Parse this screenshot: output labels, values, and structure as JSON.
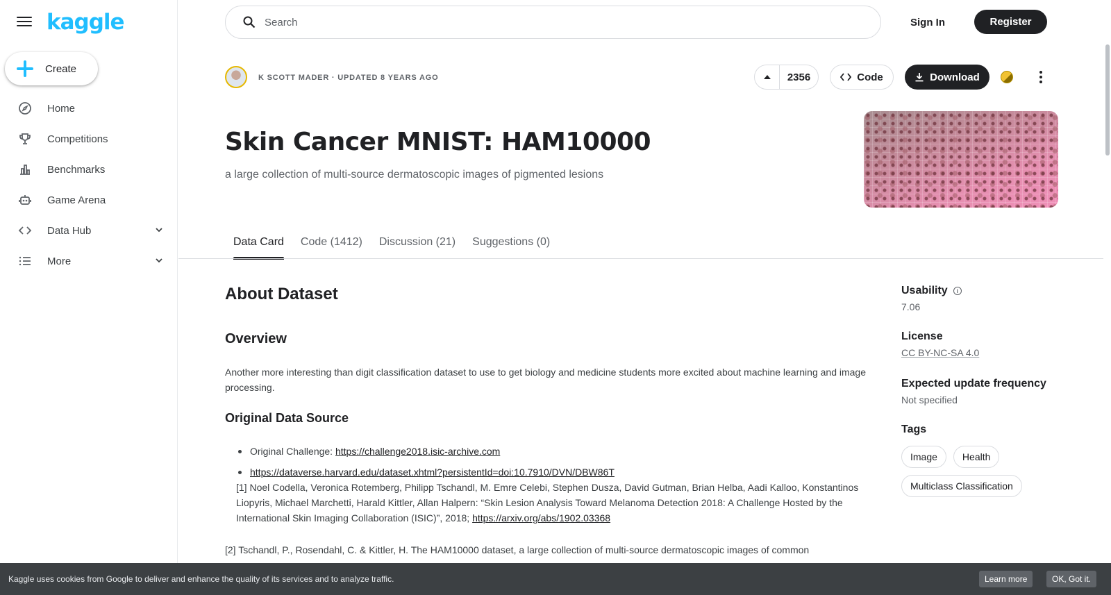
{
  "app": {
    "logo_text": "kaggle",
    "brand_color": "#20beff"
  },
  "sidebar": {
    "create_label": "Create",
    "items": [
      {
        "label": "Home",
        "icon": "compass-icon"
      },
      {
        "label": "Competitions",
        "icon": "trophy-icon"
      },
      {
        "label": "Benchmarks",
        "icon": "bar-chart-icon"
      },
      {
        "label": "Game Arena",
        "icon": "robot-icon"
      },
      {
        "label": "Data Hub",
        "icon": "code-brackets-icon",
        "expandable": true
      },
      {
        "label": "More",
        "icon": "list-icon",
        "expandable": true
      }
    ]
  },
  "topbar": {
    "search_placeholder": "Search",
    "signin_label": "Sign In",
    "register_label": "Register"
  },
  "dataset": {
    "byline": "K Scott Mader · Updated 8 years ago",
    "upvotes": "2356",
    "code_label": "Code",
    "download_label": "Download",
    "title": "Skin Cancer MNIST: HAM10000",
    "subtitle": "a large collection of multi-source dermatoscopic images of pigmented lesions"
  },
  "tabs": [
    {
      "label": "Data Card",
      "active": true
    },
    {
      "label": "Code (1412)"
    },
    {
      "label": "Discussion (21)"
    },
    {
      "label": "Suggestions (0)"
    }
  ],
  "content": {
    "about_heading": "About Dataset",
    "overview_heading": "Overview",
    "overview_text": "Another more interesting than digit classification dataset to use to get biology and medicine students more excited about machine learning and image processing.",
    "source_heading": "Original Data Source",
    "challenge_prefix": "Original Challenge: ",
    "challenge_link": "https://challenge2018.isic-archive.com",
    "dataverse_link": "https://dataverse.harvard.edu/dataset.xhtml?persistentId=doi:10.7910/DVN/DBW86T",
    "ref1_text": "[1] Noel Codella, Veronica Rotemberg, Philipp Tschandl, M. Emre Celebi, Stephen Dusza, David Gutman, Brian Helba, Aadi Kalloo, Konstantinos Liopyris, Michael Marchetti, Harald Kittler, Allan Halpern: “Skin Lesion Analysis Toward Melanoma Detection 2018: A Challenge Hosted by the International Skin Imaging Collaboration (ISIC)”, 2018; ",
    "ref1_link": "https://arxiv.org/abs/1902.03368",
    "ref2_text": "[2] Tschandl, P., Rosendahl, C. & Kittler, H. The HAM10000 dataset, a large collection of multi-source dermatoscopic images of common"
  },
  "meta": {
    "usability_label": "Usability",
    "usability_value": "7.06",
    "license_label": "License",
    "license_value": "CC BY-NC-SA 4.0",
    "frequency_label": "Expected update frequency",
    "frequency_value": "Not specified",
    "tags_label": "Tags",
    "tags": [
      "Image",
      "Health",
      "Multiclass Classification"
    ]
  },
  "cookie": {
    "text": "Kaggle uses cookies from Google to deliver and enhance the quality of its services and to analyze traffic.",
    "learn_label": "Learn more",
    "ok_label": "OK, Got it."
  }
}
